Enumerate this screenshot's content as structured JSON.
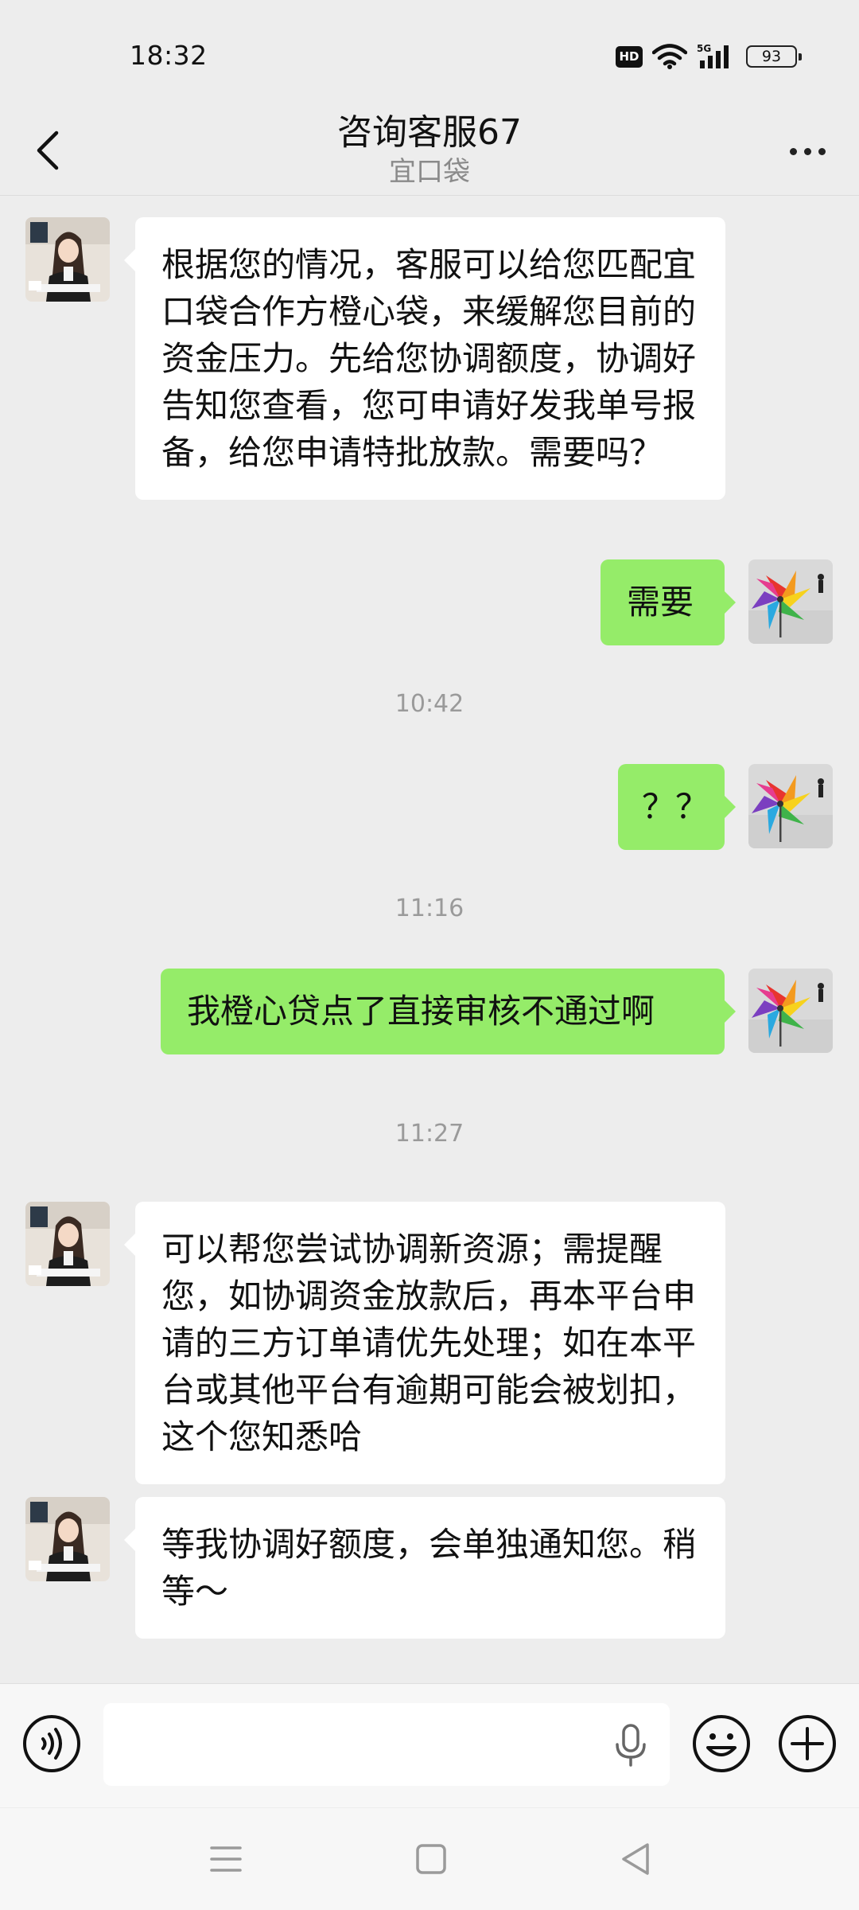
{
  "status_bar": {
    "time": "18:32",
    "hd_badge": "HD",
    "network": "5G",
    "battery": "93",
    "icons": [
      "hd-icon",
      "wifi-icon",
      "signal-5g-icon",
      "battery-icon"
    ]
  },
  "header": {
    "title": "咨询客服67",
    "subtitle": "宜口袋",
    "back_icon": "chevron-left-icon",
    "more_icon": "more-dots-icon"
  },
  "messages": [
    {
      "side": "in",
      "text": "根据您的情况，客服可以给您匹配宜口袋合作方橙心袋，来缓解您目前的资金压力。先给您协调额度，协调好告知您查看，您可申请好发我单号报备，给您申请特批放款。需要吗？"
    },
    {
      "side": "out",
      "text": "需要"
    },
    {
      "timestamp": "10:42"
    },
    {
      "side": "out",
      "text": "？？"
    },
    {
      "timestamp": "11:16"
    },
    {
      "side": "out",
      "text": "我橙心贷点了直接审核不通过啊"
    },
    {
      "timestamp": "11:27"
    },
    {
      "side": "in",
      "text": "可以帮您尝试协调新资源；需提醒您，如协调资金放款后，再本平台申请的三方订单请优先处理；如在本平台或其他平台有逾期可能会被划扣，这个您知悉哈"
    },
    {
      "side": "in",
      "text": "等我协调好额度，会单独通知您。稍等～"
    }
  ],
  "input_bar": {
    "placeholder": "",
    "icons": [
      "voice-icon",
      "mic-icon",
      "emoji-icon",
      "plus-icon"
    ]
  },
  "nav_bar": {
    "icons": [
      "menu-icon",
      "home-icon",
      "back-triangle-icon"
    ]
  },
  "colors": {
    "background": "#ededed",
    "bubble_in": "#ffffff",
    "bubble_out": "#95ec69",
    "timestamp_text": "#9a9a9a"
  }
}
